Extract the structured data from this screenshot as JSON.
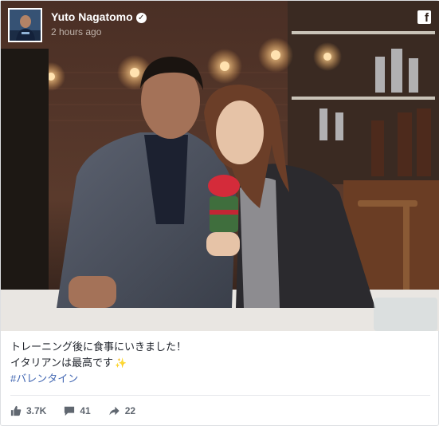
{
  "post": {
    "author_name": "Yuto Nagatomo",
    "verified_icon": "verified-badge-icon",
    "timestamp": "2 hours ago",
    "platform_icon": "facebook-icon"
  },
  "caption": {
    "line1": "トレーニング後に食事にいきました！",
    "line2": "イタリアンは最高です",
    "sparkle_icon": "sparkles-icon",
    "hashtag": "#バレンタイン"
  },
  "stats": {
    "likes": "3.7K",
    "comments": "41",
    "shares": "22"
  },
  "colors": {
    "hashtag": "#4267b2",
    "stat_text": "#606770",
    "header_overlay": "#2a1c16"
  }
}
